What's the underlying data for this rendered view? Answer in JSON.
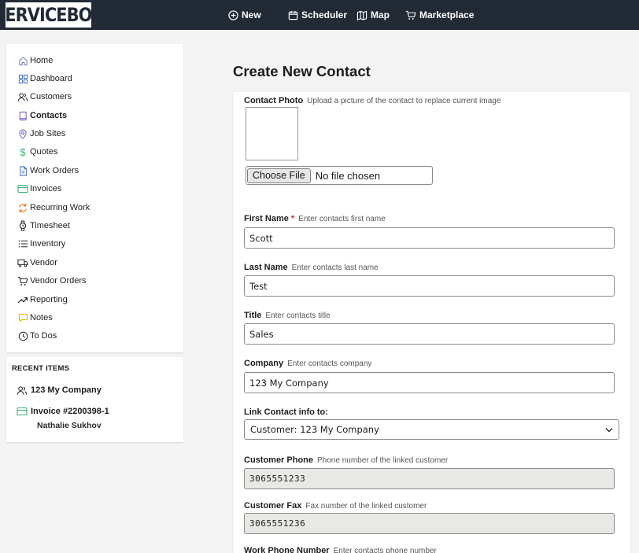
{
  "app": {
    "logo_text": "SERVICEBOX"
  },
  "topnav": {
    "new": "New",
    "scheduler": "Scheduler",
    "map": "Map",
    "marketplace": "Marketplace"
  },
  "sidebar": {
    "items": [
      {
        "label": "Home",
        "icon": "home-icon"
      },
      {
        "label": "Dashboard",
        "icon": "dashboard-icon"
      },
      {
        "label": "Customers",
        "icon": "users-icon"
      },
      {
        "label": "Contacts",
        "icon": "book-icon",
        "active": true
      },
      {
        "label": "Job Sites",
        "icon": "map-pin-icon"
      },
      {
        "label": "Quotes",
        "icon": "dollar-icon"
      },
      {
        "label": "Work Orders",
        "icon": "document-icon"
      },
      {
        "label": "Invoices",
        "icon": "credit-card-icon"
      },
      {
        "label": "Recurring Work",
        "icon": "refresh-icon"
      },
      {
        "label": "Timesheet",
        "icon": "watch-icon"
      },
      {
        "label": "Inventory",
        "icon": "list-icon"
      },
      {
        "label": "Vendor",
        "icon": "truck-icon"
      },
      {
        "label": "Vendor Orders",
        "icon": "cart-icon"
      },
      {
        "label": "Reporting",
        "icon": "trending-up-icon"
      },
      {
        "label": "Notes",
        "icon": "note-icon"
      },
      {
        "label": "To Dos",
        "icon": "clock-icon"
      }
    ]
  },
  "recent": {
    "title": "RECENT ITEMS",
    "items": [
      {
        "label": "123 My Company",
        "icon": "users-icon"
      },
      {
        "label": "Invoice #2200398-1",
        "sub": "Nathalie Sukhov",
        "icon": "credit-card-icon"
      }
    ]
  },
  "main": {
    "title": "Create New Contact",
    "photo": {
      "label": "Contact Photo",
      "hint": "Upload a picture of the contact to replace current image",
      "button": "Choose File",
      "status": "No file chosen"
    },
    "first_name": {
      "label": "First Name",
      "required": "*",
      "hint": "Enter contacts first name",
      "value": "Scott"
    },
    "last_name": {
      "label": "Last Name",
      "hint": "Enter contacts last name",
      "value": "Test"
    },
    "title_field": {
      "label": "Title",
      "hint": "Enter contacts title",
      "value": "Sales"
    },
    "company": {
      "label": "Company",
      "hint": "Enter contacts company",
      "value": "123 My Company"
    },
    "link": {
      "label": "Link Contact info to:",
      "value": "Customer: 123 My Company"
    },
    "customer_phone": {
      "label": "Customer Phone",
      "hint": "Phone number of the linked customer",
      "value": "3065551233"
    },
    "customer_fax": {
      "label": "Customer Fax",
      "hint": "Fax number of the linked customer",
      "value": "3065551236"
    },
    "work_phone": {
      "label": "Work Phone Number",
      "hint": "Enter contacts phone number"
    }
  },
  "colors": {
    "topbar": "#222a36",
    "accent_purple": "#7b61c9",
    "accent_green": "#3cb371",
    "accent_orange": "#f07a2a",
    "required": "#d62828"
  }
}
